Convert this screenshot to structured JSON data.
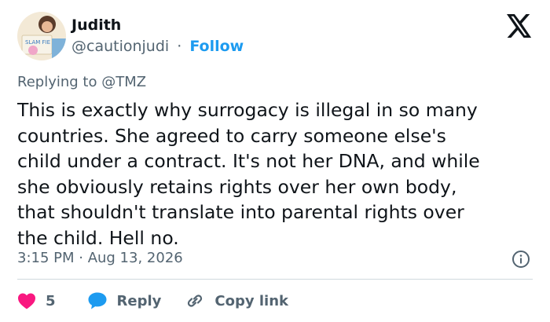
{
  "author": {
    "name": "Judith",
    "handle": "@cautionjudi",
    "separator": "·",
    "follow_label": "Follow",
    "avatar_sign_text": "SLAM FIE"
  },
  "reply_context": "Replying to @TMZ",
  "tweet": {
    "lines": [
      "This is exactly why surrogacy is illegal in so many",
      "countries. She agreed to carry someone else's",
      "child under a contract. It's not her DNA, and while",
      "she obviously retains rights over her own body,",
      "that shouldn't translate into parental rights over",
      "the child. Hell no."
    ]
  },
  "timestamp": "3:15 PM · Aug 13, 2026",
  "actions": {
    "like_count": "5",
    "reply_label": "Reply",
    "copy_link_label": "Copy link"
  },
  "colors": {
    "like": "#f91880",
    "reply": "#1d9bf0",
    "follow": "#1d9bf0",
    "muted": "#536471"
  },
  "icons": {
    "logo": "x-logo-icon",
    "info": "info-icon",
    "like": "heart-icon",
    "reply": "speech-bubble-icon",
    "copy_link": "link-icon"
  }
}
